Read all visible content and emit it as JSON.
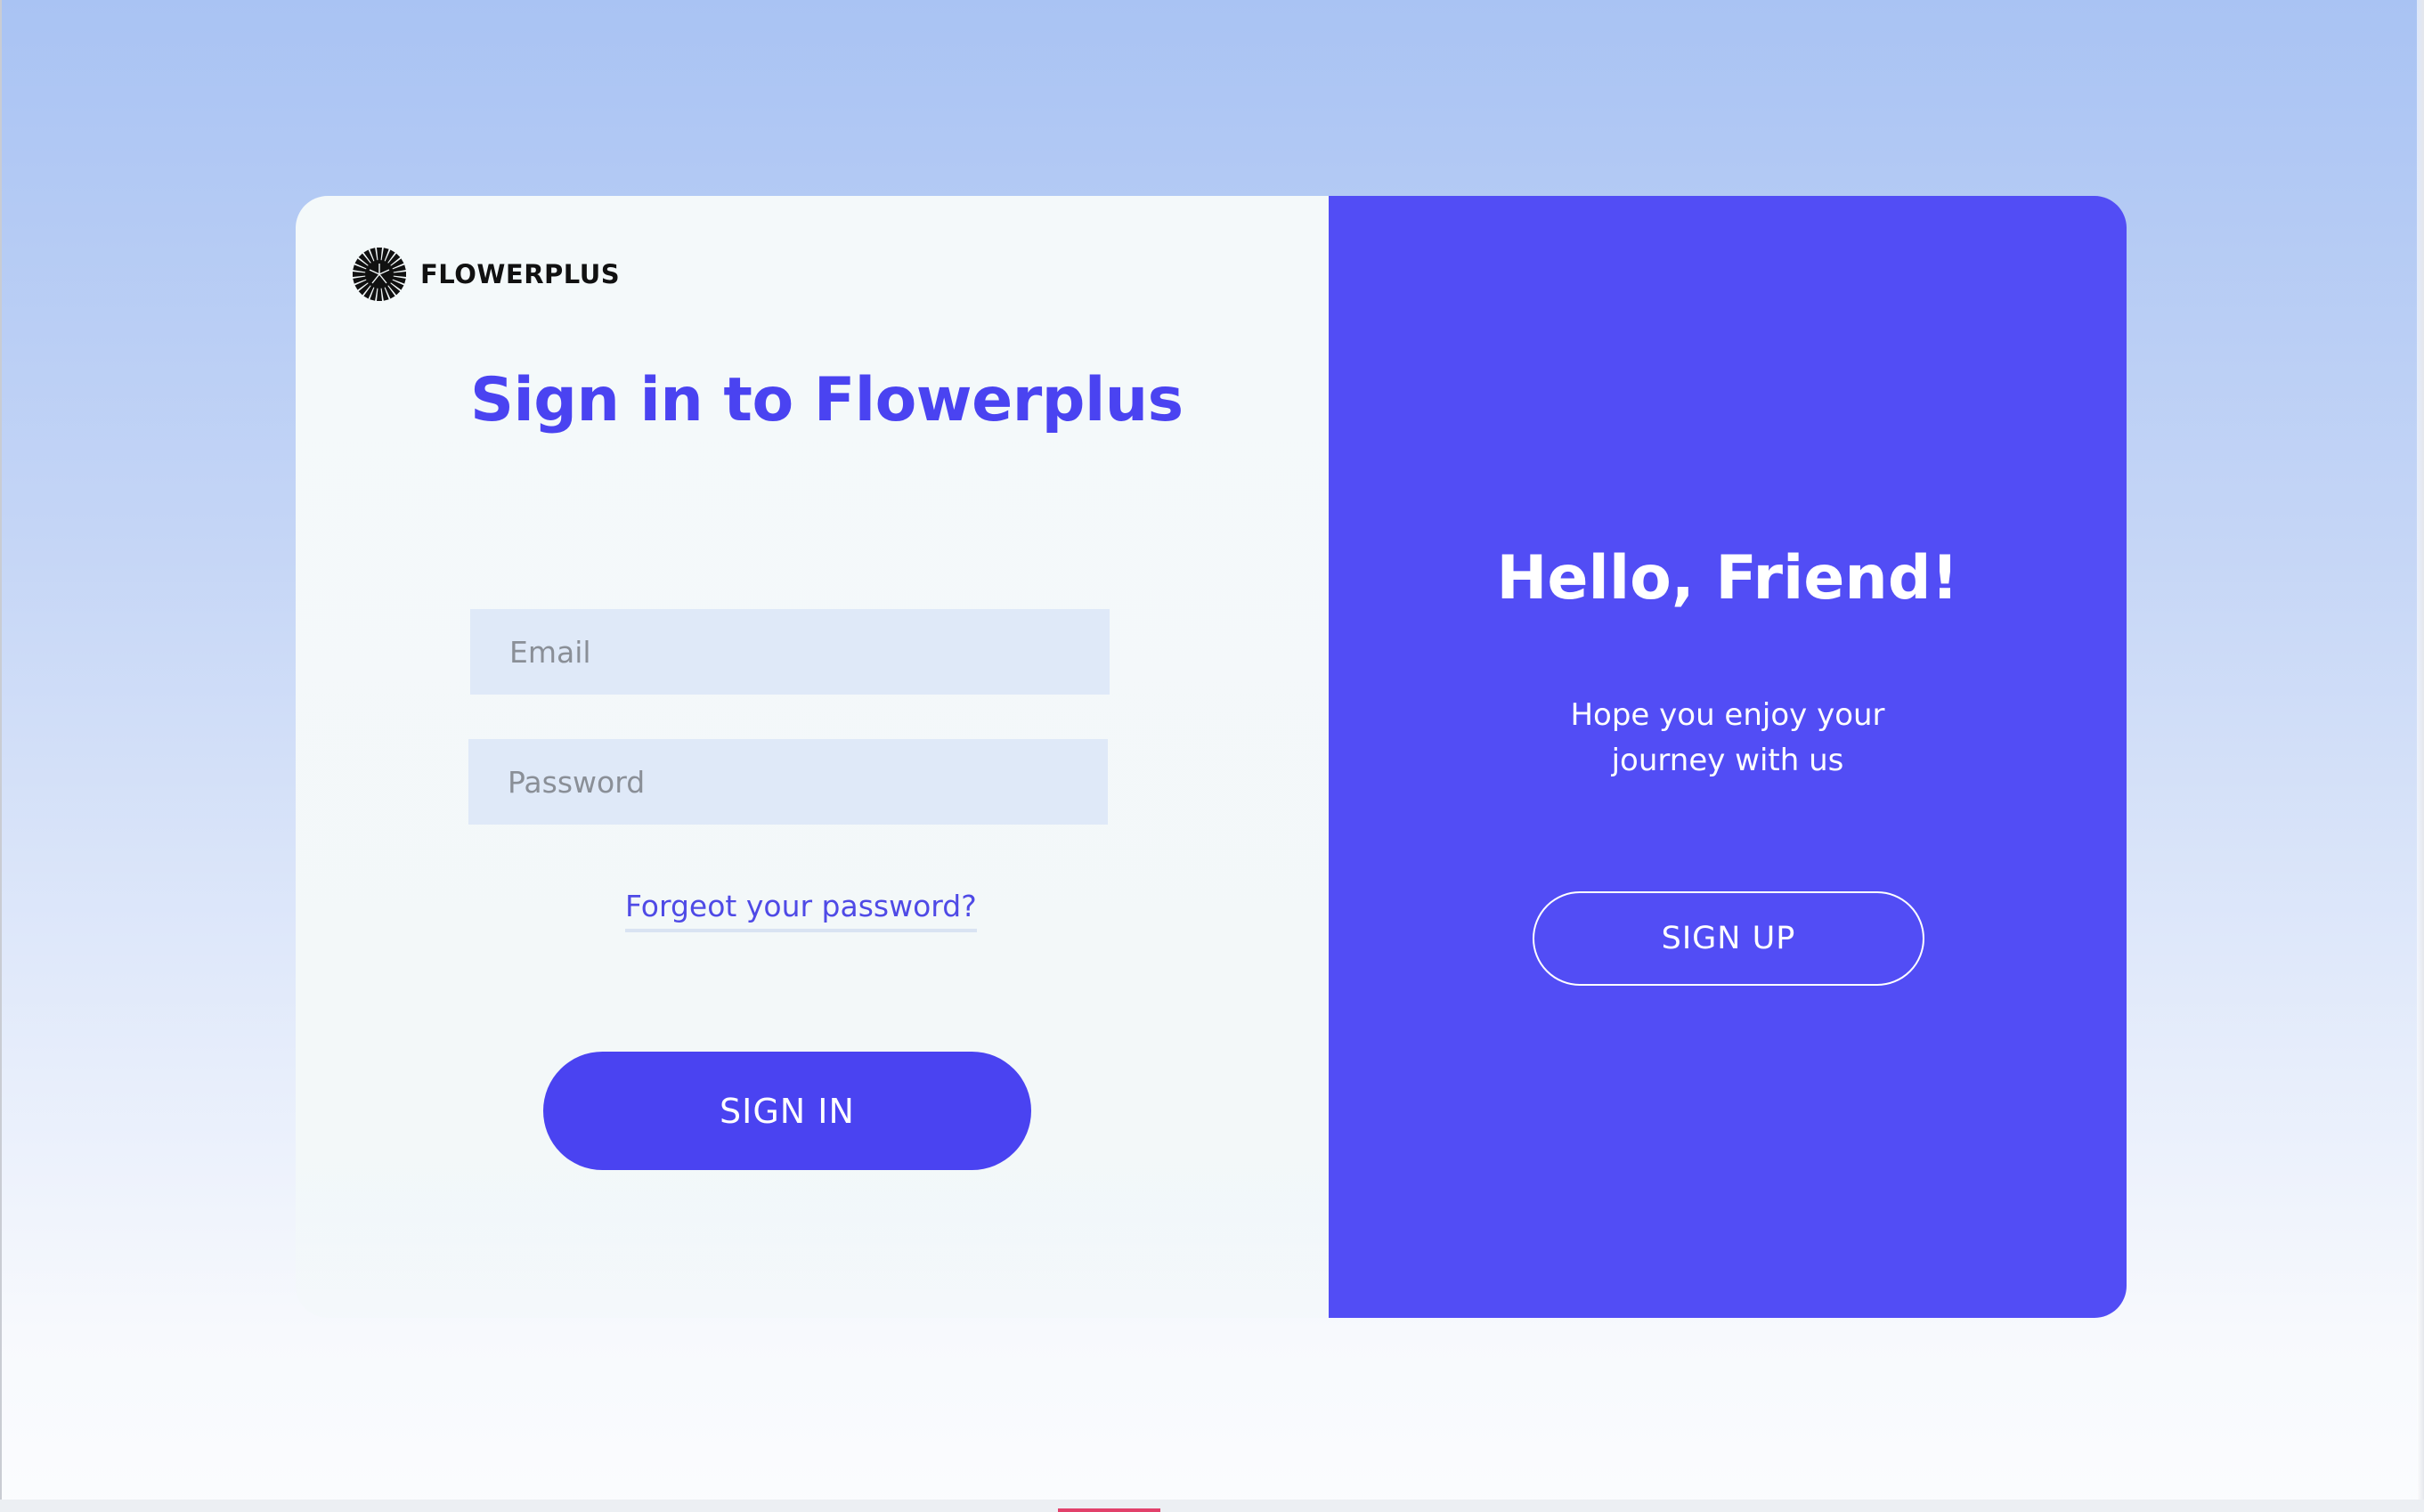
{
  "brand": {
    "name": "FLOWERPLUS",
    "logo_icon": "flower-logo-icon"
  },
  "signin": {
    "title": "Sign in to Flowerplus",
    "email_placeholder": "Email",
    "password_placeholder": "Password",
    "forgot_link": "Forgeot your password?",
    "button_label": "SIGN IN"
  },
  "welcome": {
    "heading": "Hello, Friend!",
    "subtitle": "Hope you enjoy your journey with us",
    "button_label": "SIGN UP"
  },
  "colors": {
    "accent": "#4a43f1",
    "panel": "#524df5",
    "input_bg": "#dfe9f8",
    "background_top": "#a9c3f3",
    "background_bottom": "#fbfcfe"
  }
}
